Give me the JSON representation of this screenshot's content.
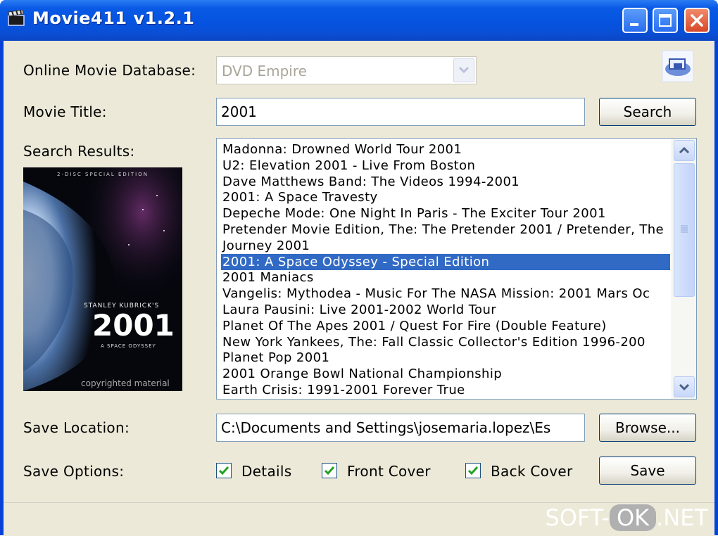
{
  "window": {
    "title": "Movie411 v1.2.1"
  },
  "form": {
    "database_label": "Online Movie Database:",
    "database_value": "DVD Empire",
    "title_label": "Movie Title:",
    "title_value": "2001",
    "search_button": "Search",
    "results_label": "Search Results:",
    "results": [
      "Madonna: Drowned World Tour 2001",
      "U2: Elevation 2001 - Live From Boston",
      "Dave Matthews Band: The Videos 1994-2001",
      "2001: A Space Travesty",
      "Depeche Mode: One Night In Paris - The Exciter Tour 2001",
      "Pretender Movie Edition, The: The Pretender 2001 / Pretender, The",
      "Journey 2001",
      "2001: A Space Odyssey - Special Edition",
      "2001 Maniacs",
      "Vangelis: Mythodea - Music For The NASA Mission: 2001 Mars Oc",
      "Laura Pausini: Live 2001-2002 World Tour",
      "Planet Of The Apes 2001 / Quest For Fire (Double Feature)",
      "New York Yankees, The: Fall Classic Collector's Edition 1996-200",
      "Planet Pop 2001",
      "2001 Orange Bowl National Championship",
      "Earth Crisis: 1991-2001 Forever True"
    ],
    "selected_index": 7,
    "poster": {
      "edition": "2-DISC SPECIAL EDITION",
      "director": "STANLEY KUBRICK'S",
      "title": "2001",
      "subtitle": "A SPACE ODYSSEY",
      "copyright": "copyrighted material"
    },
    "save_location_label": "Save Location:",
    "save_location_value": "C:\\Documents and Settings\\josemaria.lopez\\Es",
    "browse_button": "Browse...",
    "save_options_label": "Save Options:",
    "options": [
      {
        "label": "Details",
        "checked": true
      },
      {
        "label": "Front Cover",
        "checked": true
      },
      {
        "label": "Back Cover",
        "checked": true
      }
    ],
    "save_button": "Save"
  },
  "watermark": {
    "left": "SOFT-",
    "mid": "OK",
    "right": ".NET"
  }
}
